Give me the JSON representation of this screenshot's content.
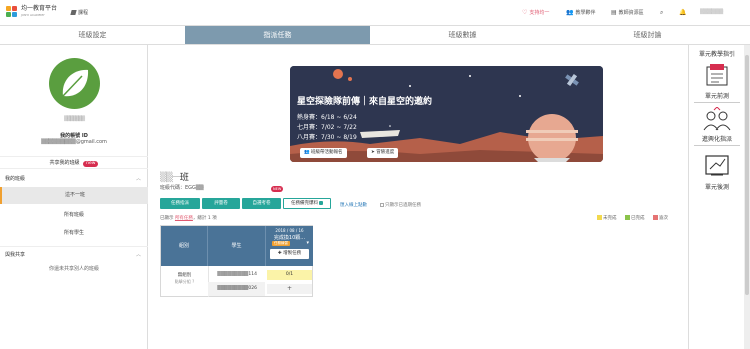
{
  "topbar": {
    "logo_title": "均一教育平台",
    "logo_sub": "JUNYI ACADEMY",
    "home_label": "課程",
    "support_label": "支持均一",
    "teacher_community_label": "教學夥伴",
    "teacher_guide_label": "教師資源區",
    "user_name": "▒▒▒▒▒▒"
  },
  "tabs": [
    "班級設定",
    "指派任務",
    "班級數據",
    "班級討論"
  ],
  "sidebar": {
    "account_name": "▒▒▒▒▒▒▒",
    "account_id_label": "我的帳號 ID",
    "account_email": "▒▒▒▒▒▒▒▒▒@gmail.com",
    "share_label": "共享我的班級",
    "share_badge": "new",
    "my_classes_label": "我的班級",
    "classes": [
      "這不一班",
      "所有班級",
      "所有學生"
    ],
    "shared_label": "與我共享",
    "shared_empty": "你還未共享別人的班級"
  },
  "banner": {
    "title": "星空探險隊前傳｜來自星空的邀約",
    "lines": [
      "熱身賽：6/18 ~ 6/24",
      "七月賽：7/02 ~ 7/22",
      "八月賽：7/30 ~ 8/19"
    ],
    "btn_signup": "班級帶活動報名",
    "btn_progress": "冒險進度"
  },
  "class": {
    "name_blur": "▒▒一",
    "name_suffix": "班",
    "code": "班級代碼：EGG▒▒"
  },
  "actions": {
    "btn1": "任務指派",
    "btn2": "評量卷",
    "btn3": "自選考卷",
    "btn4": "任務備完爆料",
    "new_badge": "NEW",
    "link_print": "匯入線上點數",
    "checkbox": "只顯示已過期任務"
  },
  "showing": {
    "prefix": "已顯示",
    "link": "所有任務",
    "suffix": "，總計 1 項"
  },
  "legend": [
    "未完成",
    "已完成",
    "逾次"
  ],
  "legend_colors": [
    "#f2d94e",
    "#8bc34a",
    "#e57373"
  ],
  "table": {
    "col_group": "組別",
    "col_student": "學生",
    "task_date": "2018 / 08 / 16",
    "task_name": "完成換10顆...",
    "task_tag": "任務練習",
    "add_task": "✚ 增製任務",
    "group_name": "無組別",
    "group_sub": "點擊分組 ?",
    "students": [
      "▒▒▒▒▒▒▒▒▒114",
      "▒▒▒▒▒▒▒▒▒026"
    ],
    "scores": [
      "0/1",
      "+"
    ]
  },
  "rsidebar": {
    "title": "單元教學指引",
    "items": [
      "單元前測",
      "進興化指派",
      "單元後測"
    ]
  }
}
